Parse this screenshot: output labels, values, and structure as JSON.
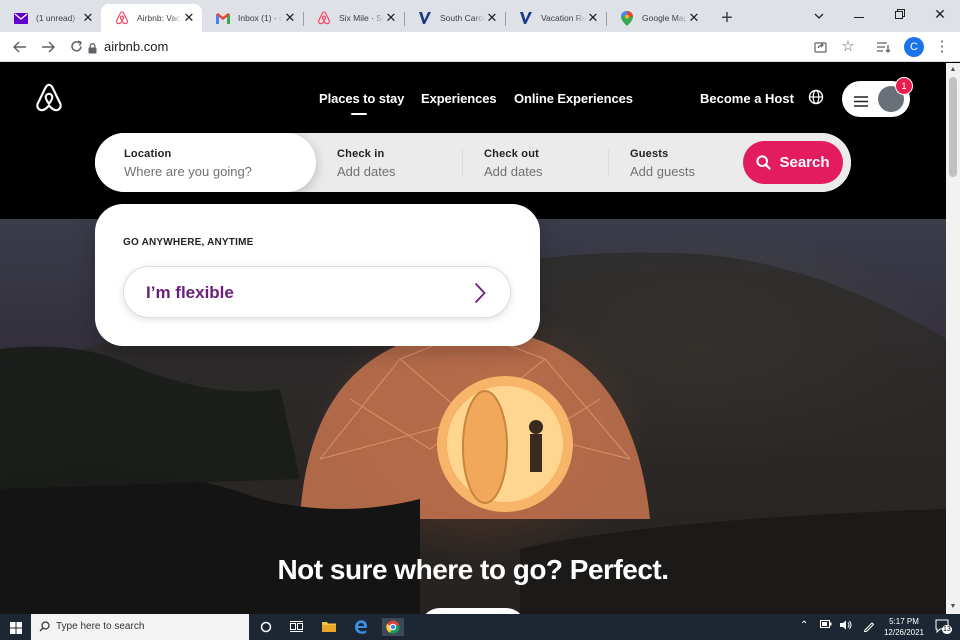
{
  "browser": {
    "tabs": [
      {
        "title": "(1 unread) -",
        "favicon": "yahoo-mail-icon",
        "active": false
      },
      {
        "title": "Airbnb: Vaca",
        "favicon": "airbnb-icon",
        "active": true
      },
      {
        "title": "Inbox (1) - c",
        "favicon": "gmail-icon",
        "active": false
      },
      {
        "title": "Six Mile · Sta",
        "favicon": "airbnb-icon",
        "active": false
      },
      {
        "title": "South Caroli",
        "favicon": "vrbo-icon",
        "active": false
      },
      {
        "title": "Vacation Re",
        "favicon": "vrbo-icon",
        "active": false
      },
      {
        "title": "Google Map",
        "favicon": "google-maps-icon",
        "active": false
      }
    ],
    "url": "airbnb.com",
    "profile_initial": "C"
  },
  "header": {
    "nav": [
      "Places to stay",
      "Experiences",
      "Online Experiences"
    ],
    "become_host": "Become a Host",
    "notification_count": "1"
  },
  "search": {
    "location_label": "Location",
    "location_placeholder": "Where are you going?",
    "checkin_label": "Check in",
    "checkin_placeholder": "Add dates",
    "checkout_label": "Check out",
    "checkout_placeholder": "Add dates",
    "guests_label": "Guests",
    "guests_placeholder": "Add guests",
    "button_label": "Search"
  },
  "dropdown": {
    "title": "GO ANYWHERE, ANYTIME",
    "flexible_label": "I’m flexible"
  },
  "hero": {
    "title": "Not sure where to go? Perfect."
  },
  "taskbar": {
    "search_placeholder": "Type here to search",
    "time": "5:17 PM",
    "date": "12/26/2021",
    "notification_count": "13"
  },
  "colors": {
    "brand": "#e31c5f",
    "flexible_text": "#6c1f7a"
  }
}
